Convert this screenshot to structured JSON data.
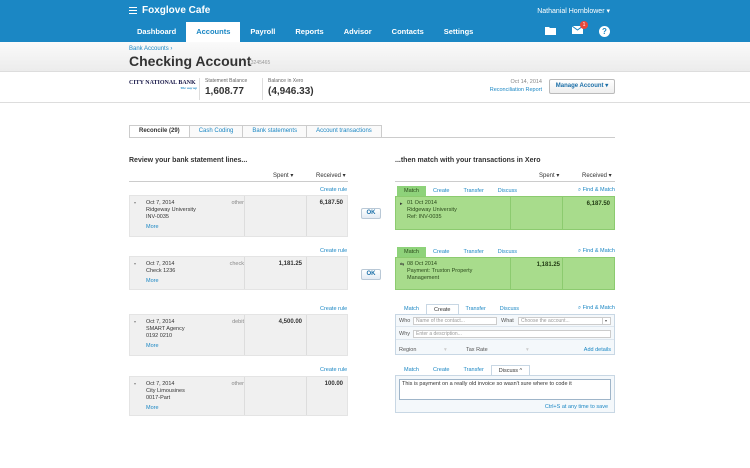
{
  "header": {
    "org_name": "Foxglove Cafe",
    "user_name": "Nathanial Hornblower ▾",
    "notification_count": "1",
    "help_label": "?"
  },
  "nav": {
    "items": [
      "Dashboard",
      "Accounts",
      "Payroll",
      "Reports",
      "Advisor",
      "Contacts",
      "Settings"
    ],
    "active": "Accounts"
  },
  "page": {
    "breadcrumb": "Bank Accounts ›",
    "title": "Checking Account",
    "account_number": "13245465"
  },
  "summary": {
    "bank_name": "CITY NATIONAL BANK",
    "bank_tagline": "The way up",
    "statement_balance_label": "Statement Balance",
    "statement_balance": "1,608.77",
    "xero_balance_label": "Balance in Xero",
    "xero_balance": "(4,946.33)",
    "reconcile_date": "Oct 14, 2014",
    "reconcile_report": "Reconciliation Report",
    "manage_account": "Manage Account ▾"
  },
  "tabs": [
    "Reconcile (29)",
    "Cash Coding",
    "Bank statements",
    "Account transactions"
  ],
  "left": {
    "title": "Review your bank statement lines...",
    "spent": "Spent ▾",
    "received": "Received ▾",
    "create_rule": "Create rule",
    "more": "More",
    "lines": [
      {
        "date": "Oct 7, 2014",
        "payee": "Ridgeway University",
        "ref": "INV-0035",
        "type": "other",
        "spent": "",
        "received": "6,187.50"
      },
      {
        "date": "Oct 7, 2014",
        "payee": "Check 1236",
        "ref": "",
        "type": "check",
        "spent": "1,181.25",
        "received": ""
      },
      {
        "date": "Oct 7, 2014",
        "payee": "SMART Agency",
        "ref": "0192 0210",
        "type": "debit",
        "spent": "4,500.00",
        "received": ""
      },
      {
        "date": "Oct 7, 2014",
        "payee": "City Limousines",
        "ref": "0017-Part",
        "type": "other",
        "spent": "",
        "received": "100.00"
      }
    ]
  },
  "ok_label": "OK",
  "right": {
    "title": "...then match with your transactions in Xero",
    "spent": "Spent ▾",
    "received": "Received ▾",
    "tab_labels": [
      "Match",
      "Create",
      "Transfer",
      "Discuss"
    ],
    "discuss_active": "Discuss ^",
    "find_match": "⌕ Find & Match",
    "matches": [
      {
        "date": "01 Oct 2014",
        "line2": "Ridgeway University",
        "line3": "Ref: INV-0035",
        "spent": "",
        "received": "6,187.50"
      },
      {
        "date": "08 Oct 2014",
        "line2": "Payment: Truxton Property",
        "line3": "Management",
        "spent": "1,181.25",
        "received": ""
      }
    ],
    "form": {
      "who_label": "Who",
      "who_placeholder": "Name of the contact...",
      "what_label": "What",
      "what_placeholder": "Choose the account...",
      "why_label": "Why",
      "why_placeholder": "Enter a description...",
      "region": "Region",
      "tax_rate": "Tax Rate",
      "add_details": "Add details"
    },
    "discuss": {
      "text": "This is payment on a really old invoice so wasn't sure where to code it",
      "hint": "Ctrl+S at any time to save"
    }
  }
}
